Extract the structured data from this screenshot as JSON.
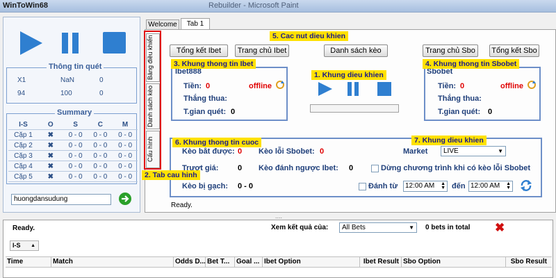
{
  "window": {
    "title": "WinToWin68",
    "caption": "Rebuilder - Microsoft Paint"
  },
  "tabs": [
    "Welcome",
    "Tab 1"
  ],
  "vertical_tabs": [
    "Bảng điều khiển",
    "Danh sách kèo",
    "Cấu hình"
  ],
  "left": {
    "scan_info_title": "Thông tin quét",
    "scan_rows": [
      [
        "X1",
        "NaN",
        "0"
      ],
      [
        "94",
        "100",
        "0"
      ]
    ],
    "summary_title": "Summary",
    "summary_head": [
      "I-S",
      "O",
      "S",
      "C",
      "M"
    ],
    "summary_rows": [
      [
        "Cặp 1",
        "0 - 0",
        "0 - 0",
        "0 - 0"
      ],
      [
        "Cặp 2",
        "0 - 0",
        "0 - 0",
        "0 - 0"
      ],
      [
        "Cặp 3",
        "0 - 0",
        "0 - 0",
        "0 - 0"
      ],
      [
        "Cặp 4",
        "0 - 0",
        "0 - 0",
        "0 - 0"
      ],
      [
        "Cặp 5",
        "0 - 0",
        "0 - 0",
        "0 - 0"
      ]
    ],
    "user_value": "huongdansudung"
  },
  "toolbar": {
    "tong_ket_ibet": "Tổng kết Ibet",
    "trang_chu_ibet": "Trang chủ Ibet",
    "danh_sach_keo": "Danh sách kèo",
    "trang_chu_sbo": "Trang chủ Sbo",
    "tong_ket_sbo": "Tổng kết Sbo"
  },
  "annotations": {
    "a5": "5. Cac nut dieu khien",
    "a3": "3. Khung thong tin Ibet",
    "a1": "1. Khung dieu khien",
    "a4": "4. Khung thong tin Sbobet",
    "a6": "6. Khung thong tin cuoc",
    "a7": "7. Khung dieu khien",
    "a2": "2. Tab cau hinh"
  },
  "ibet": {
    "name": "Ibet888",
    "tien_label": "Tiền:",
    "tien": "0",
    "status": "offline",
    "thang_thua": "Thắng thua:",
    "tgian": "T.gian quét:",
    "tgian_val": "0"
  },
  "sbo": {
    "name": "Sbobet",
    "tien_label": "Tiền:",
    "tien": "0",
    "status": "offline",
    "thang_thua": "Thắng thua:",
    "tgian": "T.gian quét:",
    "tgian_val": "0"
  },
  "bet": {
    "keo_bat_duoc": "Kèo bắt được:",
    "keo_bat_duoc_val": "0",
    "keo_loi_sbo": "Kèo lỗi Sbobet:",
    "keo_loi_sbo_val": "0",
    "market_label": "Market",
    "market_value": "LIVE",
    "truot_gia": "Trượt giá:",
    "truot_gia_val": "0",
    "keo_danh_nguoc": "Kèo đánh ngược Ibet:",
    "keo_danh_nguoc_val": "0",
    "dung_chuong_trinh": "Dừng chương trình khi có kèo lỗi Sbobet",
    "keo_bi_gach": "Kèo bị gạch:",
    "keo_bi_gach_val": "0 - 0",
    "danh_tu": "Đánh từ",
    "time_from": "12:00 AM",
    "den": "đến",
    "time_to": "12:00 AM"
  },
  "status_ready": "Ready.",
  "splitter": "....",
  "bottom": {
    "ready": "Ready.",
    "xem_ket_qua": "Xem kết quả của:",
    "filter_value": "All Bets",
    "bets_total": "0 bets in total",
    "group_by": "I-S",
    "columns": [
      "Time",
      "Match",
      "Odds D...",
      "Bet T...",
      "Goal ...",
      "Ibet Option",
      "Ibet Result",
      "Sbo Option",
      "Sbo Result"
    ]
  },
  "colors": {
    "accent": "#2f7fd0",
    "annotation": "#ffe100",
    "offline": "#e00000",
    "frame": "#6d8fc8"
  }
}
